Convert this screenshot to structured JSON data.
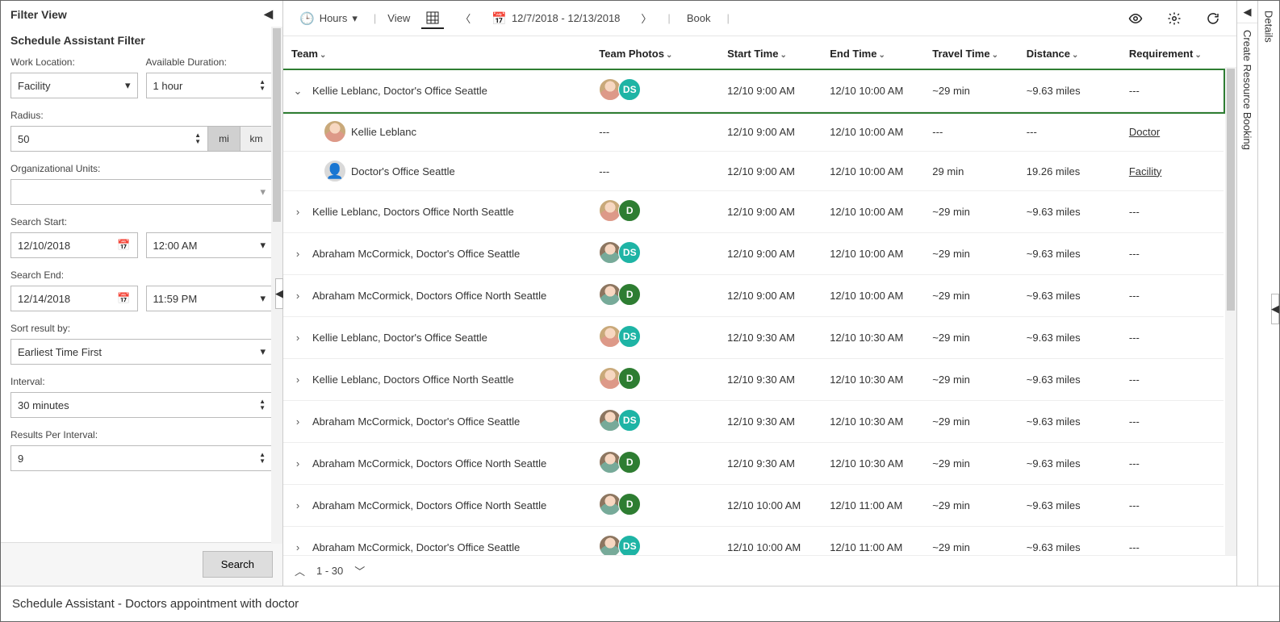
{
  "filter": {
    "panel_title": "Filter View",
    "subtitle": "Schedule Assistant Filter",
    "labels": {
      "work_location": "Work Location:",
      "available_duration": "Available Duration:",
      "radius": "Radius:",
      "org_units": "Organizational Units:",
      "search_start": "Search Start:",
      "search_end": "Search End:",
      "sort_by": "Sort result by:",
      "interval": "Interval:",
      "results_per_interval": "Results Per Interval:"
    },
    "values": {
      "work_location": "Facility",
      "available_duration": "1 hour",
      "radius": "50",
      "unit_mi": "mi",
      "unit_km": "km",
      "org_units": "",
      "search_start_date": "12/10/2018",
      "search_start_time": "12:00 AM",
      "search_end_date": "12/14/2018",
      "search_end_time": "11:59 PM",
      "sort_by": "Earliest Time First",
      "interval": "30 minutes",
      "results_per_interval": "9"
    },
    "search_button": "Search"
  },
  "toolbar": {
    "hours": "Hours",
    "view": "View",
    "date_range": "12/7/2018 - 12/13/2018",
    "book": "Book"
  },
  "grid": {
    "columns": {
      "team": "Team",
      "photos": "Team Photos",
      "start": "Start Time",
      "end": "End Time",
      "travel": "Travel Time",
      "distance": "Distance",
      "requirement": "Requirement"
    },
    "rows": [
      {
        "type": "parent",
        "expanded": true,
        "team": "Kellie Leblanc, Doctor's Office Seattle",
        "photos": [
          "person1",
          "badge-teal-DS"
        ],
        "start": "12/10 9:00 AM",
        "end": "12/10 10:00 AM",
        "travel": "~29 min",
        "distance": "~9.63 miles",
        "requirement": "---",
        "selected": true
      },
      {
        "type": "child",
        "team": "Kellie Leblanc",
        "photos": [
          "person1"
        ],
        "start": "12/10 9:00 AM",
        "end": "12/10 10:00 AM",
        "travel": "---",
        "distance": "---",
        "requirement_link": "Doctor"
      },
      {
        "type": "child",
        "team": "Doctor's Office Seattle",
        "photos": [
          "generic"
        ],
        "start": "12/10 9:00 AM",
        "end": "12/10 10:00 AM",
        "travel": "29 min",
        "distance": "19.26 miles",
        "requirement_link": "Facility"
      },
      {
        "type": "parent",
        "expanded": false,
        "team": "Kellie Leblanc, Doctors Office North Seattle",
        "photos": [
          "person1",
          "badge-green-D"
        ],
        "start": "12/10 9:00 AM",
        "end": "12/10 10:00 AM",
        "travel": "~29 min",
        "distance": "~9.63 miles",
        "requirement": "---"
      },
      {
        "type": "parent",
        "expanded": false,
        "team": "Abraham McCormick, Doctor's Office Seattle",
        "photos": [
          "person2",
          "badge-teal-DS"
        ],
        "start": "12/10 9:00 AM",
        "end": "12/10 10:00 AM",
        "travel": "~29 min",
        "distance": "~9.63 miles",
        "requirement": "---"
      },
      {
        "type": "parent",
        "expanded": false,
        "team": "Abraham McCormick, Doctors Office North Seattle",
        "photos": [
          "person2",
          "badge-green-D"
        ],
        "start": "12/10 9:00 AM",
        "end": "12/10 10:00 AM",
        "travel": "~29 min",
        "distance": "~9.63 miles",
        "requirement": "---"
      },
      {
        "type": "parent",
        "expanded": false,
        "team": "Kellie Leblanc, Doctor's Office Seattle",
        "photos": [
          "person1",
          "badge-teal-DS"
        ],
        "start": "12/10 9:30 AM",
        "end": "12/10 10:30 AM",
        "travel": "~29 min",
        "distance": "~9.63 miles",
        "requirement": "---"
      },
      {
        "type": "parent",
        "expanded": false,
        "team": "Kellie Leblanc, Doctors Office North Seattle",
        "photos": [
          "person1",
          "badge-green-D"
        ],
        "start": "12/10 9:30 AM",
        "end": "12/10 10:30 AM",
        "travel": "~29 min",
        "distance": "~9.63 miles",
        "requirement": "---"
      },
      {
        "type": "parent",
        "expanded": false,
        "team": "Abraham McCormick, Doctor's Office Seattle",
        "photos": [
          "person2",
          "badge-teal-DS"
        ],
        "start": "12/10 9:30 AM",
        "end": "12/10 10:30 AM",
        "travel": "~29 min",
        "distance": "~9.63 miles",
        "requirement": "---"
      },
      {
        "type": "parent",
        "expanded": false,
        "team": "Abraham McCormick, Doctors Office North Seattle",
        "photos": [
          "person2",
          "badge-green-D"
        ],
        "start": "12/10 9:30 AM",
        "end": "12/10 10:30 AM",
        "travel": "~29 min",
        "distance": "~9.63 miles",
        "requirement": "---"
      },
      {
        "type": "parent",
        "expanded": false,
        "team": "Abraham McCormick, Doctors Office North Seattle",
        "photos": [
          "person2",
          "badge-green-D"
        ],
        "start": "12/10 10:00 AM",
        "end": "12/10 11:00 AM",
        "travel": "~29 min",
        "distance": "~9.63 miles",
        "requirement": "---"
      },
      {
        "type": "parent",
        "expanded": false,
        "team": "Abraham McCormick, Doctor's Office Seattle",
        "photos": [
          "person2",
          "badge-teal-DS"
        ],
        "start": "12/10 10:00 AM",
        "end": "12/10 11:00 AM",
        "travel": "~29 min",
        "distance": "~9.63 miles",
        "requirement": "---"
      }
    ],
    "child_photos_dash": "---",
    "pager": "1 - 30"
  },
  "right_rail": {
    "create_booking": "Create Resource Booking",
    "details": "Details"
  },
  "footer": {
    "text": "Schedule Assistant - Doctors appointment with doctor"
  }
}
